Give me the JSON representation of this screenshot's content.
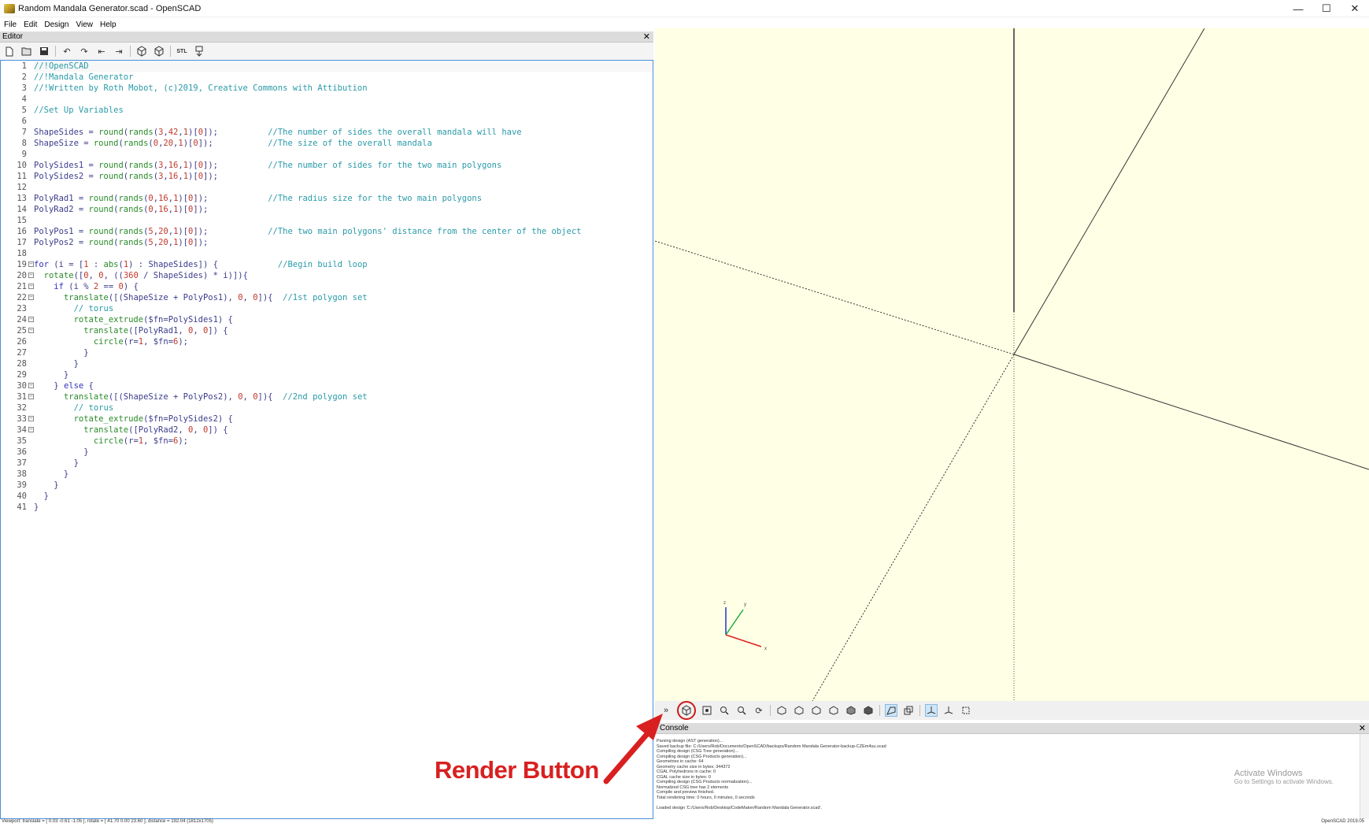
{
  "window": {
    "title": "Random Mandala Generator.scad - OpenSCAD",
    "controls": [
      "—",
      "☐",
      "✕"
    ]
  },
  "menu": [
    "File",
    "Edit",
    "Design",
    "View",
    "Help"
  ],
  "editor": {
    "dock_title": "Editor",
    "close": "✕",
    "toolbar_icons": [
      "new-file-icon",
      "open-file-icon",
      "save-icon",
      "undo-icon",
      "redo-icon",
      "unindent-icon",
      "indent-icon",
      "preview-icon",
      "render-icon",
      "export-stl-icon",
      "send-to-print-icon"
    ],
    "stl_label": "STL",
    "lines": [
      "//!OpenSCAD",
      "//!Mandala Generator",
      "//!Written by Roth Mobot, (c)2019, Creative Commons with Attibution",
      "",
      "//Set Up Variables",
      "",
      "ShapeSides = round(rands(3,42,1)[0]);          //The number of sides the overall mandala will have",
      "ShapeSize = round(rands(0,20,1)[0]);           //The size of the overall mandala",
      "",
      "PolySides1 = round(rands(3,16,1)[0]);          //The number of sides for the two main polygons",
      "PolySides2 = round(rands(3,16,1)[0]);",
      "",
      "PolyRad1 = round(rands(0,16,1)[0]);            //The radius size for the two main polygons",
      "PolyRad2 = round(rands(0,16,1)[0]);",
      "",
      "PolyPos1 = round(rands(5,20,1)[0]);            //The two main polygons' distance from the center of the object",
      "PolyPos2 = round(rands(5,20,1)[0]);",
      "",
      "for (i = [1 : abs(1) : ShapeSides]) {            //Begin build loop",
      "  rotate([0, 0, ((360 / ShapeSides) * i)]){",
      "    if (i % 2 == 0) {",
      "      translate([(ShapeSize + PolyPos1), 0, 0]){  //1st polygon set",
      "        // torus",
      "        rotate_extrude($fn=PolySides1) {",
      "          translate([PolyRad1, 0, 0]) {",
      "            circle(r=1, $fn=6);",
      "          }",
      "        }",
      "      }",
      "    } else {",
      "      translate([(ShapeSize + PolyPos2), 0, 0]){  //2nd polygon set",
      "        // torus",
      "        rotate_extrude($fn=PolySides2) {",
      "          translate([PolyRad2, 0, 0]) {",
      "            circle(r=1, $fn=6);",
      "          }",
      "        }",
      "      }",
      "    }",
      "  }",
      "}"
    ]
  },
  "viewport": {
    "background": "#ffffe5",
    "axis_labels": [
      "z",
      "y",
      "x"
    ]
  },
  "view_toolbar_icons": [
    "collapse-icon",
    "render-icon",
    "view-all-icon",
    "zoom-in-icon",
    "zoom-out-icon",
    "reset-view-icon",
    "view-right-icon",
    "view-top-icon",
    "view-bottom-icon",
    "view-left-icon",
    "view-front-icon",
    "view-back-icon",
    "perspective-icon",
    "orthogonal-icon",
    "show-axes-icon",
    "show-scale-markers-icon",
    "show-edges-icon"
  ],
  "console": {
    "title": "Console",
    "close": "✕",
    "lines": [
      "Parsing design (AST generation)...",
      "Saved backup file: C:/Users/Rob/Documents/OpenSCAD/backups/Random Mandala Generator-backup-CZEm4uu.scad",
      "Compiling design (CSG Tree generation)...",
      "Compiling design (CSG Products generation)...",
      "Geometries in cache: 64",
      "Geometry cache size in bytes: 344372",
      "CGAL Polyhedrons in cache: 0",
      "CGAL cache size in bytes: 0",
      "Compiling design (CSG Products normalization)...",
      "Normalized CSG tree has 2 elements",
      "Compile and preview finished.",
      "Total rendering time: 0 hours, 0 minutes, 0 seconds",
      "",
      "Loaded design 'C:/Users/Rob/Desktop/CodeMaker/Random Mandala Generator.scad'."
    ],
    "activate_title": "Activate Windows",
    "activate_sub": "Go to Settings to activate Windows."
  },
  "status": {
    "left": "Viewport: translate = [ 0.03 -0.61 -1.05 ], rotate = [ 41.70 0.00 23.60 ], distance = 192.04 (1812x1705)",
    "right": "OpenSCAD 2019.05"
  },
  "annotation": {
    "label": "Render Button",
    "color": "#d82020"
  }
}
